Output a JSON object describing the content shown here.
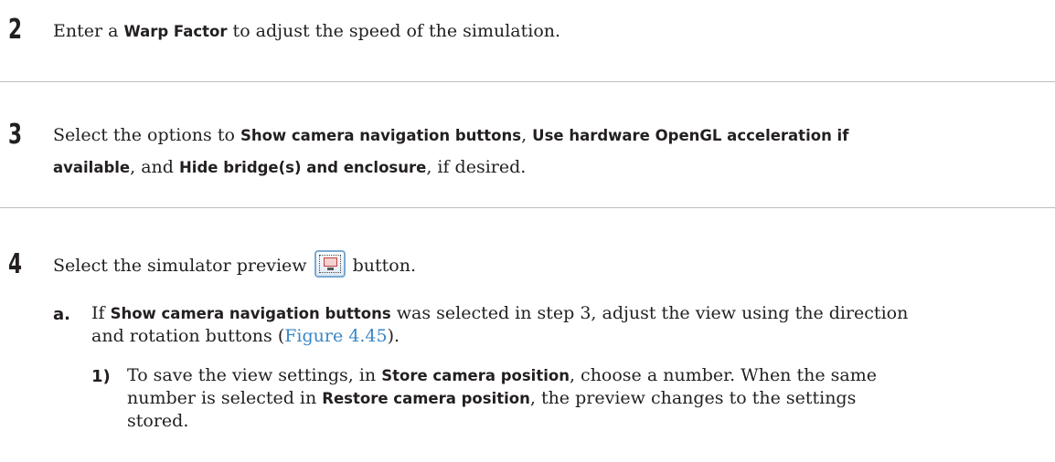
{
  "steps": [
    {
      "number": "2",
      "p1": "Enter a ",
      "b1": "Warp Factor",
      "p2": " to adjust the speed of the simulation."
    },
    {
      "number": "3",
      "p1": "Select the options to ",
      "b1": "Show camera navigation buttons",
      "p2": ", ",
      "b2": "Use hardware OpenGL acceleration if",
      "b3": "available",
      "p3": ", and ",
      "b4": "Hide bridge(s) and enclosure",
      "p4": ", if desired."
    },
    {
      "number": "4",
      "p1": "Select the simulator preview",
      "icon": "simulator-preview-icon",
      "p2": "button."
    }
  ],
  "substep_a": {
    "label": "a.",
    "p1": "If ",
    "b1": "Show camera navigation buttons",
    "p2": " was selected in step 3, adjust the view using the direction",
    "p3": "and rotation buttons (",
    "link": "Figure 4.45",
    "p4": ")."
  },
  "substep_1": {
    "label": "1)",
    "p1": "To save the view settings, in ",
    "b1": "Store camera position",
    "p2": ", choose a number. When the same",
    "p3": "number is selected in ",
    "b2": "Restore camera position",
    "p4": ", the preview changes to the settings",
    "p5": "stored."
  },
  "colors": {
    "link": "#3a86c6",
    "rule": "#bdbdbd",
    "text": "#231f20"
  }
}
